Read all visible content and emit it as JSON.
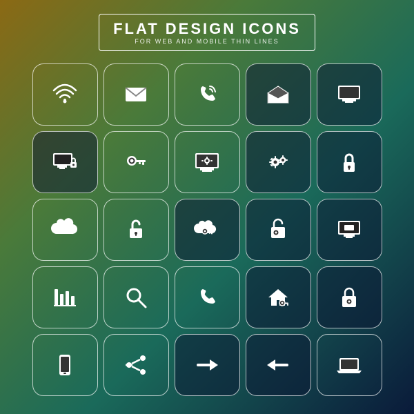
{
  "header": {
    "title": "FLAT DESIGN ICONS",
    "subtitle": "FOR WEB AND MOBILE THIN LINES"
  },
  "icons": [
    {
      "name": "wifi",
      "row": 1
    },
    {
      "name": "mail-closed",
      "row": 1
    },
    {
      "name": "phone",
      "row": 1
    },
    {
      "name": "mail-open",
      "row": 1
    },
    {
      "name": "monitor",
      "row": 1
    },
    {
      "name": "monitor-key",
      "row": 2
    },
    {
      "name": "key",
      "row": 2
    },
    {
      "name": "monitor-settings",
      "row": 2
    },
    {
      "name": "gears",
      "row": 2
    },
    {
      "name": "lock",
      "row": 2
    },
    {
      "name": "cloud",
      "row": 3
    },
    {
      "name": "unlock-box",
      "row": 3
    },
    {
      "name": "cloud-key",
      "row": 3
    },
    {
      "name": "unlock-key",
      "row": 3
    },
    {
      "name": "monitor-2",
      "row": 3
    },
    {
      "name": "chart",
      "row": 4
    },
    {
      "name": "search",
      "row": 4
    },
    {
      "name": "phone-2",
      "row": 4
    },
    {
      "name": "home-key",
      "row": 4
    },
    {
      "name": "lock-key",
      "row": 4
    },
    {
      "name": "mobile",
      "row": 5
    },
    {
      "name": "share",
      "row": 5
    },
    {
      "name": "arrow-right",
      "row": 5
    },
    {
      "name": "arrow-left",
      "row": 5
    },
    {
      "name": "laptop",
      "row": 5
    }
  ]
}
